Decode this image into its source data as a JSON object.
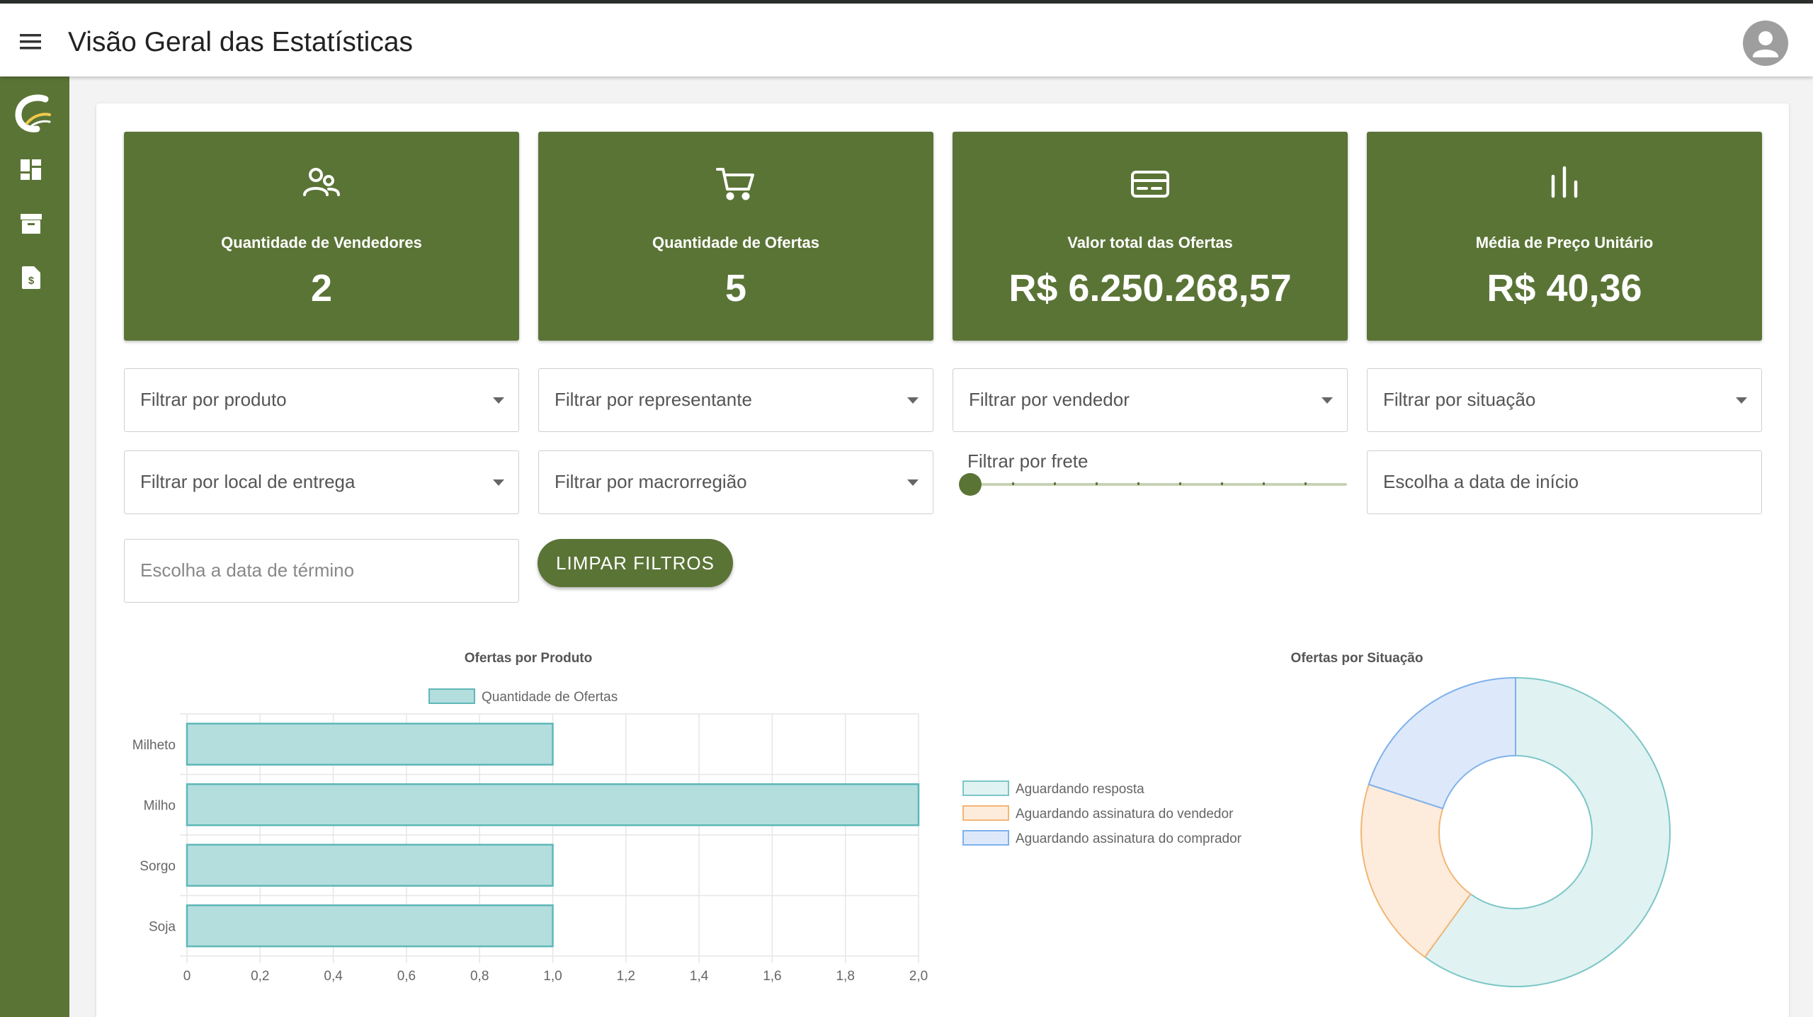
{
  "header": {
    "title": "Visão Geral das Estatísticas"
  },
  "sidebar": {
    "items": [
      {
        "icon": "dashboard-icon"
      },
      {
        "icon": "archive-icon"
      },
      {
        "icon": "invoice-icon"
      }
    ]
  },
  "stats": [
    {
      "icon": "users-icon",
      "label": "Quantidade de Vendedores",
      "value": "2"
    },
    {
      "icon": "cart-icon",
      "label": "Quantidade de Ofertas",
      "value": "5"
    },
    {
      "icon": "credit-card-icon",
      "label": "Valor total das Ofertas",
      "value": "R$ 6.250.268,57"
    },
    {
      "icon": "bar-chart-icon",
      "label": "Média de Preço Unitário",
      "value": "R$ 40,36"
    }
  ],
  "filters": {
    "produto": "Filtrar por produto",
    "representante": "Filtrar por representante",
    "vendedor": "Filtrar por vendedor",
    "situacao": "Filtrar por situação",
    "local_entrega": "Filtrar por local de entrega",
    "macrorregiao": "Filtrar por macrorregião",
    "frete": "Filtrar por frete",
    "data_inicio": "Escolha a data de início",
    "data_termino": "Escolha a data de término",
    "clear_label": "LIMPAR FILTROS"
  },
  "colors": {
    "brand": "#5a7436",
    "bar_fill": "#b4dede",
    "bar_border": "#5fb7b7"
  },
  "chart_data": [
    {
      "type": "bar",
      "orientation": "horizontal",
      "title": "Ofertas por Produto",
      "categories": [
        "Milheto",
        "Milho",
        "Sorgo",
        "Soja"
      ],
      "series": [
        {
          "name": "Quantidade de Ofertas",
          "values": [
            1,
            2,
            1,
            1
          ]
        }
      ],
      "xlim": [
        0,
        2.0
      ],
      "xticks": [
        "0",
        "0,2",
        "0,4",
        "0,6",
        "0,8",
        "1,0",
        "1,2",
        "1,4",
        "1,6",
        "1,8",
        "2,0"
      ],
      "legend": "top",
      "grid": true
    },
    {
      "type": "pie",
      "subtype": "doughnut",
      "title": "Ofertas por Situação",
      "labels": [
        "Aguardando resposta",
        "Aguardando assinatura do vendedor",
        "Aguardando assinatura do comprador"
      ],
      "values": [
        3,
        1,
        1
      ],
      "colors": [
        "#e0f2f2",
        "#fdecdc",
        "#dde9fb"
      ],
      "border_colors": [
        "#7cc6c6",
        "#f3b575",
        "#7fb1ec"
      ],
      "legend": "left"
    }
  ]
}
